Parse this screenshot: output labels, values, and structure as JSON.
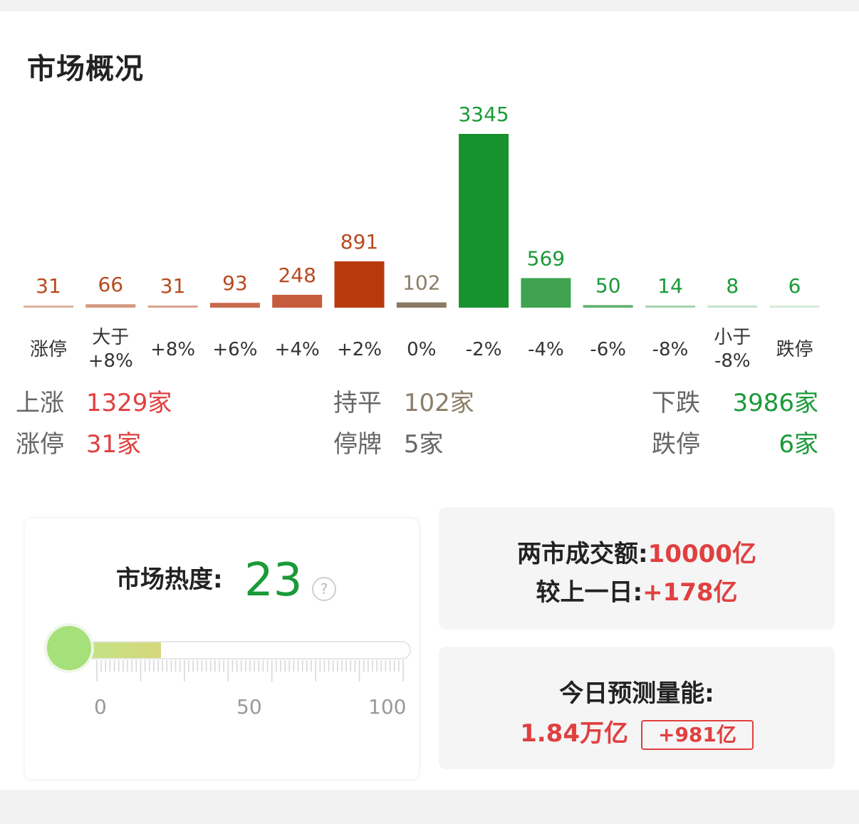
{
  "title": "市场概况",
  "chart_data": {
    "type": "bar",
    "categories": [
      "涨停",
      "大于\n+8%",
      "+8%",
      "+6%",
      "+4%",
      "+2%",
      "0%",
      "-2%",
      "-4%",
      "-6%",
      "-8%",
      "小于\n-8%",
      "跌停"
    ],
    "values": [
      31,
      66,
      31,
      93,
      248,
      891,
      102,
      3345,
      569,
      50,
      14,
      8,
      6
    ],
    "colors": [
      "#dcb39e",
      "#d49a80",
      "#d9a48e",
      "#c96a4e",
      "#c55c3c",
      "#b83a0c",
      "#8a7a63",
      "#18912f",
      "#3ea24f",
      "#62b270",
      "#a4d2ae",
      "#c6e3cb",
      "#d6ecd9"
    ],
    "label_colors": [
      "#b84a1f",
      "#b84a1f",
      "#b84a1f",
      "#b84a1f",
      "#b84a1f",
      "#b84a1f",
      "#8a7e68",
      "#1a9a38",
      "#1a9a38",
      "#1a9a38",
      "#1a9a38",
      "#1a9a38",
      "#1a9a38"
    ]
  },
  "stats": {
    "up_label": "上涨",
    "up_value": "1329家",
    "limit_up_label": "涨停",
    "limit_up_value": "31家",
    "flat_label": "持平",
    "flat_value": "102家",
    "suspend_label": "停牌",
    "suspend_value": "5家",
    "down_label": "下跌",
    "down_value": "3986家",
    "limit_down_label": "跌停",
    "limit_down_value": "6家"
  },
  "heat": {
    "label": "市场热度:",
    "value": "23",
    "level": 23,
    "help": "?",
    "ticks": [
      "0",
      "50",
      "100"
    ]
  },
  "turnover": {
    "label": "两市成交额:",
    "value": "10000亿",
    "diff_label": "较上一日:",
    "diff_value": "+178亿"
  },
  "forecast": {
    "label": "今日预测量能:",
    "value": "1.84万亿",
    "badge": "+981亿"
  }
}
